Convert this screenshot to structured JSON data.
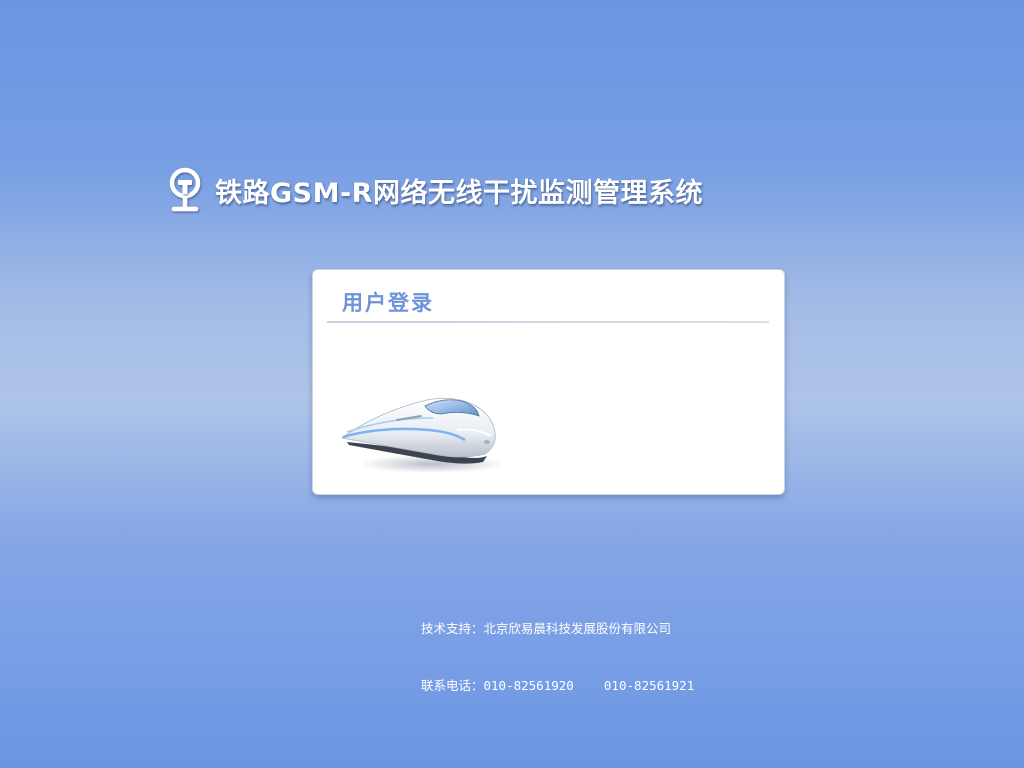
{
  "header": {
    "logo_icon": "railway-logo-icon",
    "system_title": "铁路GSM-R网络无线干扰监测管理系统"
  },
  "login_panel": {
    "heading": "用户登录",
    "illustration_icon": "high-speed-train-icon"
  },
  "footer": {
    "support_line": "技术支持：北京欣易晨科技发展股份有限公司",
    "phone_line": "联系电话：010-82561920    010-82561921"
  },
  "colors": {
    "background": "#6b96e4",
    "heading_blue": "#6f92dc",
    "panel_bg": "#ffffff"
  }
}
